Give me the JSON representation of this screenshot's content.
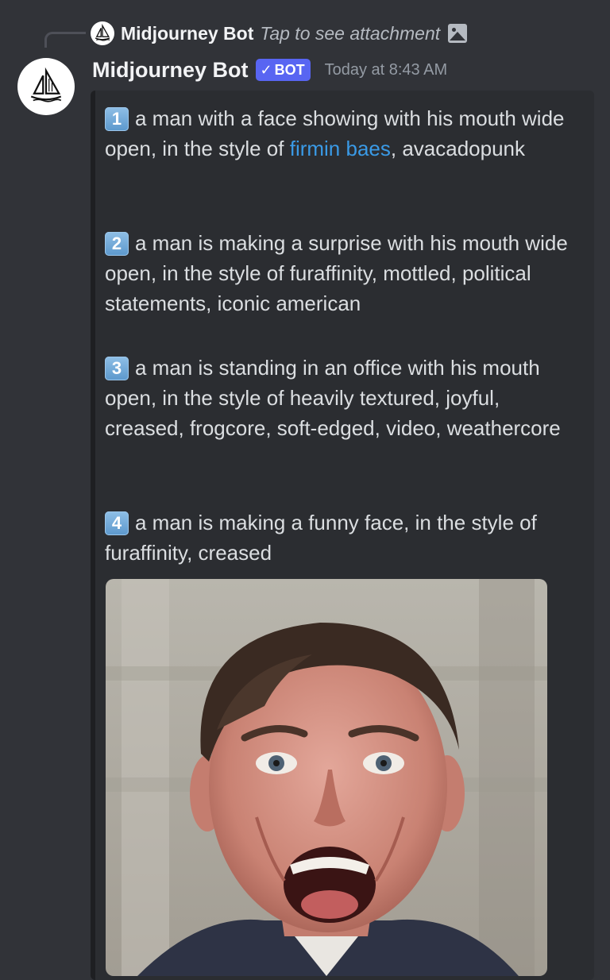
{
  "reply": {
    "author": "Midjourney Bot",
    "preview_text": "Tap to see attachment",
    "avatar_icon": "sailboat-logo-icon",
    "attachment_icon": "image-icon"
  },
  "message": {
    "author": "Midjourney Bot",
    "bot_tag_check": "✓",
    "bot_tag": "BOT",
    "timestamp": "Today at 8:43 AM",
    "avatar_icon": "sailboat-logo-icon"
  },
  "prompts": [
    {
      "number": "1",
      "text_before_link": "a man with a face showing with his mouth wide open, in the style of ",
      "link_text": "firmin baes",
      "text_after_link": ", avacadopunk"
    },
    {
      "number": "2",
      "text": "a man is making a surprise with his mouth wide open, in the style of furaffinity, mottled, political statements, iconic american"
    },
    {
      "number": "3",
      "text": "a man is standing in an office with his mouth open, in the style of heavily textured, joyful, creased, frogcore, soft-edged, video, weathercore"
    },
    {
      "number": "4",
      "text": "a man is making a funny face, in the style of furaffinity, creased"
    }
  ],
  "colors": {
    "background": "#313338",
    "embed_background": "#2b2d31",
    "bot_tag": "#5865f2",
    "link": "#3a9ae6",
    "timestamp": "#949ba4"
  },
  "attachment_image": {
    "description_icon": "generated-photo-image"
  }
}
